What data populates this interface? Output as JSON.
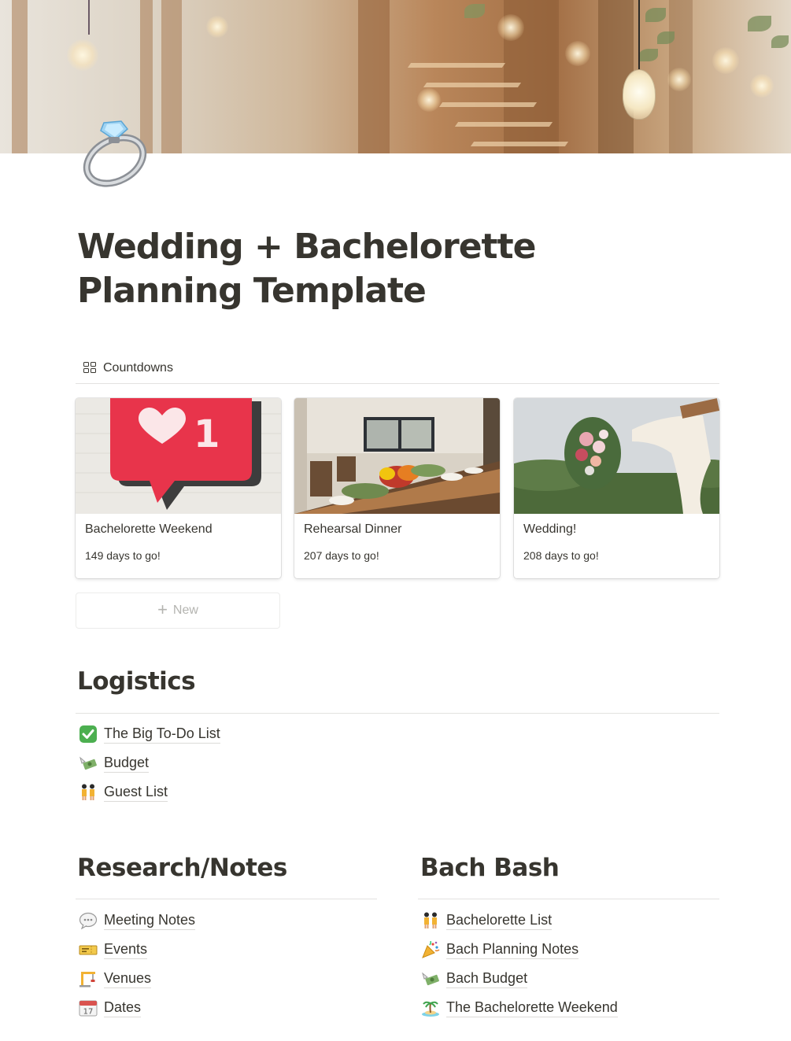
{
  "page": {
    "title": "Wedding + Bachelorette Planning Template",
    "icon": "ring-icon"
  },
  "countdowns": {
    "header": "Countdowns",
    "cards": [
      {
        "name": "Bachelorette Weekend",
        "days": "149 days to go!",
        "image": "heart-notification-mural"
      },
      {
        "name": "Rehearsal Dinner",
        "days": "207 days to go!",
        "image": "dinner-table"
      },
      {
        "name": "Wedding!",
        "days": "208 days to go!",
        "image": "flower-arch"
      }
    ],
    "new_label": "New"
  },
  "logistics": {
    "title": "Logistics",
    "items": [
      {
        "icon": "check-mark-icon",
        "label": "The Big To-Do List"
      },
      {
        "icon": "money-wings-icon",
        "label": "Budget"
      },
      {
        "icon": "dancers-icon",
        "label": "Guest List"
      }
    ]
  },
  "research": {
    "title": "Research/Notes",
    "items": [
      {
        "icon": "speech-bubble-icon",
        "label": "Meeting Notes"
      },
      {
        "icon": "ticket-icon",
        "label": "Events"
      },
      {
        "icon": "crane-icon",
        "label": "Venues"
      },
      {
        "icon": "calendar-icon",
        "label": "Dates"
      }
    ]
  },
  "bach": {
    "title": "Bach Bash",
    "items": [
      {
        "icon": "dancers-icon",
        "label": "Bachelorette List"
      },
      {
        "icon": "party-popper-icon",
        "label": "Bach Planning Notes"
      },
      {
        "icon": "money-wings-icon",
        "label": "Bach Budget"
      },
      {
        "icon": "island-icon",
        "label": "The Bachelorette Weekend"
      }
    ]
  }
}
